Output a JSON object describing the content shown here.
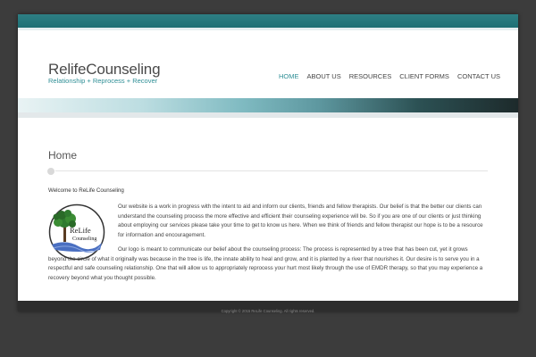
{
  "header": {
    "site_title": "RelifeCounseling",
    "tagline": "Relationship + Reprocess + Recover"
  },
  "nav": {
    "items": [
      {
        "label": "HOME"
      },
      {
        "label": "ABOUT US"
      },
      {
        "label": "RESOURCES"
      },
      {
        "label": "CLIENT FORMS"
      },
      {
        "label": "CONTACT US"
      }
    ],
    "active": "HOME"
  },
  "main": {
    "page_title": "Home",
    "welcome": "Welcome to ReLife Counseling",
    "paragraph1": "Our website is a work in progress with the intent to aid and inform our clients, friends and fellow therapists. Our belief is that the better our clients can understand the counseling process the more effective and efficient their counseling experience will be. So if you are one of our clients or just thinking about employing our services please take your time to get to know us here. When we think of friends and fellow therapist our hope is to be a resource for information and encouragement.",
    "paragraph2": "Our logo is meant to communicate our belief about the counseling process: The process is represented by a tree that has been cut, yet it grows beyond the circle of what it originally was because in the tree is life, the innate ability to heal and grow, and it is planted by a river that nourishes it. Our desire is to serve you in a respectful and safe counseling relationship. One that will allow us to appropriately reprocess your hurt most likely through the use of EMDR therapy, so that you may experience a recovery beyond what you thought possible.",
    "logo": {
      "line1": "ReLife",
      "line2": "Counseling"
    }
  },
  "footer": {
    "copyright": "Copyright © 2015 ReLife Counseling. All rights reserved."
  },
  "colors": {
    "accent": "#2f8f96",
    "topbar": "#1f6f74",
    "page_bg": "#3c3c3c",
    "footer_bg": "#2d2d2d"
  }
}
